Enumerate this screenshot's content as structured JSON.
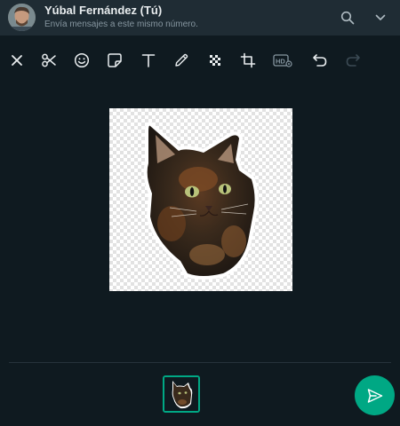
{
  "header": {
    "name": "Yúbal Fernández (Tú)",
    "subtitle": "Envía mensajes a este mismo número.",
    "search_icon": "search-icon",
    "menu_icon": "chevron-down-icon"
  },
  "toolbar": {
    "tools": [
      "close-icon",
      "scissors-icon",
      "emoji-icon",
      "sticker-icon",
      "text-icon",
      "pen-icon",
      "blur-icon",
      "crop-icon",
      "hd-icon",
      "undo-icon",
      "redo-icon"
    ]
  },
  "editor": {
    "image_subject": "sticker-cat"
  },
  "colors": {
    "accent": "#00a884",
    "background": "#0f1a20",
    "header": "#1f2c34"
  }
}
